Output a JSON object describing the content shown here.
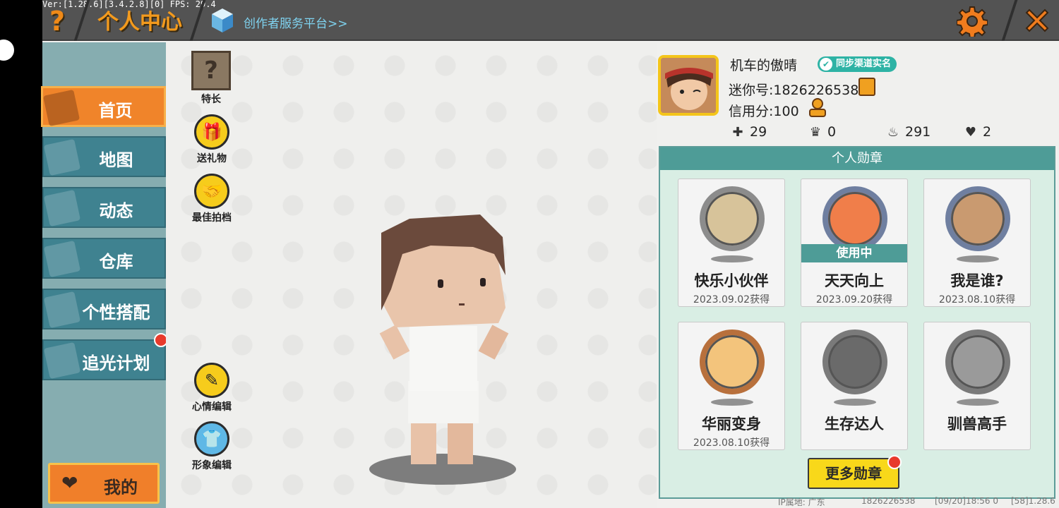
{
  "debug": {
    "version_line": "Ver:[1.28.6][3.4.2.8][0] FPS: 29.4"
  },
  "header": {
    "help_icon": "?",
    "title": "个人中心",
    "creator_link": "创作者服务平台>>",
    "settings_icon": "gear-icon",
    "close_icon": "close-icon"
  },
  "sidebar": {
    "items": [
      {
        "label": "首页",
        "active": true
      },
      {
        "label": "地图",
        "active": false
      },
      {
        "label": "动态",
        "active": false
      },
      {
        "label": "仓库",
        "active": false
      },
      {
        "label": "个性搭配",
        "active": false
      },
      {
        "label": "追光计划",
        "active": false
      }
    ],
    "my_button": "我的"
  },
  "stage": {
    "buttons": {
      "specialty": "特长",
      "gift": "送礼物",
      "partner": "最佳拍档",
      "mood_edit": "心情编辑",
      "look_edit": "形象编辑"
    }
  },
  "profile": {
    "nickname": "机车的傲晴",
    "realname_badge": "同步渠道实名",
    "mini_id": "迷你号:1826226538",
    "credit": "信用分:100",
    "stats": {
      "plus": "29",
      "trophy": "0",
      "fire": "291",
      "hearts": "2"
    }
  },
  "medals": {
    "title": "个人勋章",
    "items": [
      {
        "name": "快乐小伙伴",
        "date": "2023.09.02获得",
        "in_use": ""
      },
      {
        "name": "天天向上",
        "date": "2023.09.20获得",
        "in_use": "使用中"
      },
      {
        "name": "我是谁?",
        "date": "2023.08.10获得",
        "in_use": ""
      },
      {
        "name": "华丽变身",
        "date": "2023.08.10获得",
        "in_use": ""
      },
      {
        "name": "生存达人",
        "date": "",
        "in_use": ""
      },
      {
        "name": "驯兽高手",
        "date": "",
        "in_use": ""
      }
    ],
    "more_button": "更多勋章"
  },
  "footer": {
    "ip": "IP属地: 广东",
    "uid": "1826226538",
    "time": "[09/20]18:56 0",
    "build": "[58]1.28.6"
  },
  "colors": {
    "topbar": "#535353",
    "accent_orange": "#f0842a",
    "nav_teal": "#3f8290",
    "medal_panel": "#d9eee4",
    "medal_header": "#4e9c97",
    "button_yellow": "#f8d81a"
  }
}
